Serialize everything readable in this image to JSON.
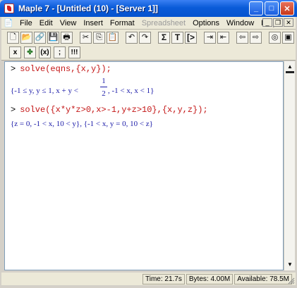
{
  "window": {
    "title": "Maple 7 - [Untitled (10) - [Server 1]]",
    "buttons": {
      "minimize": "_",
      "maximize": "□",
      "close": "✕"
    }
  },
  "menu": {
    "items": [
      {
        "label": "File",
        "enabled": true
      },
      {
        "label": "Edit",
        "enabled": true
      },
      {
        "label": "View",
        "enabled": true
      },
      {
        "label": "Insert",
        "enabled": true
      },
      {
        "label": "Format",
        "enabled": true
      },
      {
        "label": "Spreadsheet",
        "enabled": false
      },
      {
        "label": "Options",
        "enabled": true
      },
      {
        "label": "Window",
        "enabled": true
      },
      {
        "label": "Help",
        "enabled": true
      }
    ],
    "mdi_controls": [
      "_",
      "❐",
      "✕"
    ]
  },
  "toolbar": {
    "text_buttons": {
      "sigma": "Σ",
      "text": "T",
      "prompt": "[>"
    },
    "format_buttons": {
      "x": "x",
      "y": "y",
      "paren": "(x)",
      "colon": ";",
      "exclaim": "!!!"
    }
  },
  "worksheet": {
    "commands": [
      {
        "prompt": ">",
        "text": "solve(eqns,{x,y});"
      },
      {
        "prompt": ">",
        "text": "solve({x*y*z>0,x>-1,y+z>10},{x,y,z});"
      }
    ],
    "results": [
      {
        "before": "{-1 ≤ y, y ≤ 1, x + y <",
        "frac_num": "1",
        "frac_den": "2",
        "after": ", -1 < x, x < 1}"
      },
      {
        "text": "{z = 0, -1 < x, 10 < y}, {-1 < x, y = 0, 10 < z}"
      }
    ]
  },
  "status": {
    "time": "Time: 21.7s",
    "bytes": "Bytes: 4.00M",
    "available": "Available: 78.5M"
  }
}
